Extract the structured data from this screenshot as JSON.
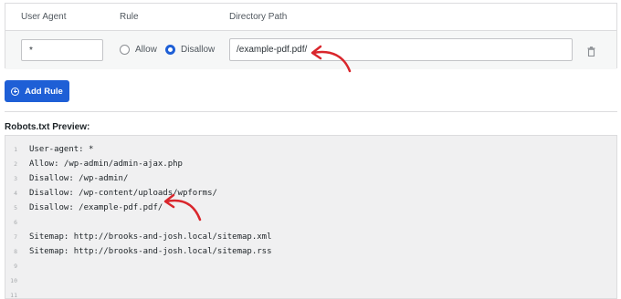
{
  "rules": {
    "headers": {
      "user_agent": "User Agent",
      "rule": "Rule",
      "directory_path": "Directory Path"
    },
    "row": {
      "user_agent_value": "*",
      "rule_options": {
        "allow": "Allow",
        "disallow": "Disallow"
      },
      "selected_rule": "Disallow",
      "path_value": "/example-pdf.pdf/"
    }
  },
  "add_rule_button": {
    "label": "Add Rule",
    "icon": "plus-circle-icon"
  },
  "preview": {
    "title": "Robots.txt Preview:",
    "lines": [
      {
        "num": "1",
        "text": "User-agent: *"
      },
      {
        "num": "2",
        "text": "Allow: /wp-admin/admin-ajax.php"
      },
      {
        "num": "3",
        "text": "Disallow: /wp-admin/"
      },
      {
        "num": "4",
        "text": "Disallow: /wp-content/uploads/wpforms/"
      },
      {
        "num": "5",
        "text": "Disallow: /example-pdf.pdf/"
      },
      {
        "num": "6",
        "text": ""
      },
      {
        "num": "7",
        "text": "Sitemap: http://brooks-and-josh.local/sitemap.xml"
      },
      {
        "num": "8",
        "text": "Sitemap: http://brooks-and-josh.local/sitemap.rss"
      },
      {
        "num": "9",
        "text": ""
      },
      {
        "num": "10",
        "text": ""
      },
      {
        "num": "11",
        "text": ""
      }
    ]
  },
  "colors": {
    "accent": "#1e5fd6",
    "annotation_arrow": "#d9262c",
    "preview_background": "#f0f0f1"
  }
}
